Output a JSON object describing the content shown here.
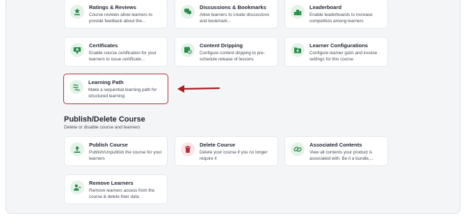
{
  "cards_top": [
    {
      "title": "Ratings & Reviews",
      "desc": "Course reviews allow learners to provide feedback about the...",
      "icon": "star-hand-icon"
    },
    {
      "title": "Discussions & Bookmarks",
      "desc": "Allow learners to create discussions and bookmark...",
      "icon": "chat-bubble-icon"
    },
    {
      "title": "Leaderboard",
      "desc": "Enable leaderboards to increase competition among learners",
      "icon": "podium-icon"
    },
    {
      "title": "Certificates",
      "desc": "Enable course certification for your learners to issue certificate...",
      "icon": "certificate-icon"
    },
    {
      "title": "Content Dripping",
      "desc": "Configure content dripping to pre-schedule release of lessons",
      "icon": "calendar-clock-icon"
    },
    {
      "title": "Learner Configurations",
      "desc": "Configure learner gstin and invoice settings for this course",
      "icon": "folder-gear-icon"
    },
    {
      "title": "Learning Path",
      "desc": "Make a sequential learning path for structured learning",
      "icon": "path-icon"
    }
  ],
  "publish_section": {
    "title": "Publish/Delete Course",
    "subtitle": "Delete or disable course and learners"
  },
  "cards_bottom": [
    {
      "title": "Publish Course",
      "desc": "Publish/Unpublish the course for your learners",
      "icon": "upload-icon"
    },
    {
      "title": "Delete Course",
      "desc": "Delete your course if you no longer require it",
      "icon": "trash-icon"
    },
    {
      "title": "Associated Contents",
      "desc": "View all contents your product is associated with. Be it a bundle,...",
      "icon": "link-icon"
    },
    {
      "title": "Remove Learners",
      "desc": "Remove learners access from the course & delete their data",
      "icon": "remove-user-icon"
    }
  ],
  "colors": {
    "accent_green": "#2e8a4c",
    "green_bg": "#e3f3e8",
    "danger_red": "#b0303a",
    "danger_bg": "#fde4e6",
    "arrow_color": "#a61e22"
  }
}
